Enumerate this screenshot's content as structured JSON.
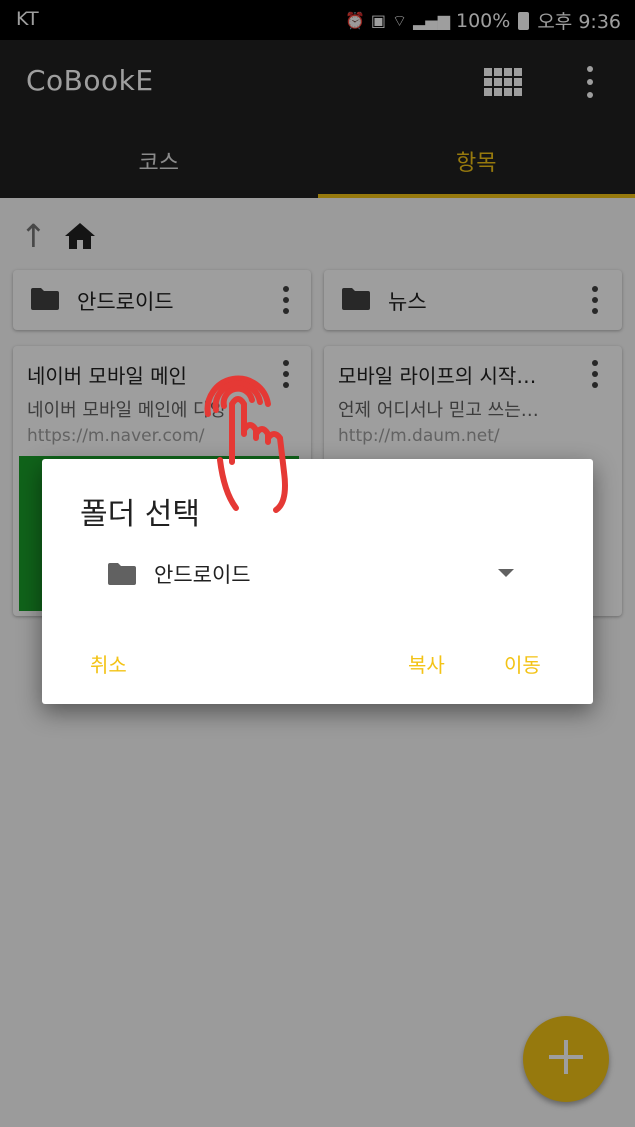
{
  "status_bar": {
    "carrier": "KT",
    "icons": [
      "alarm-icon",
      "hd-icon",
      "wifi-icon",
      "signal-icon"
    ],
    "battery": "100%",
    "time": "오후 9:36"
  },
  "toolbar": {
    "title": "CoBookE",
    "icons": [
      "grid-view-icon",
      "overflow-menu-icon"
    ]
  },
  "tabs": [
    {
      "label": "코스",
      "active": false
    },
    {
      "label": "항목",
      "active": true
    }
  ],
  "folders": [
    {
      "label": "안드로이드"
    },
    {
      "label": "뉴스"
    }
  ],
  "items": [
    {
      "title": "네이버 모바일 메인",
      "description": "네이버 모바일 메인에 다양",
      "url": "https://m.naver.com/"
    },
    {
      "title": "모바일 라이프의 시작…",
      "description": "언제 어디서나 믿고 쓰는…",
      "url": "http://m.daum.net/"
    }
  ],
  "dialog": {
    "title": "폴더 선택",
    "selected_folder": "안드로이드",
    "cancel_label": "취소",
    "copy_label": "복사",
    "move_label": "이동"
  },
  "colors": {
    "accent": "#f3c316",
    "toolbar": "#212121",
    "statusbar": "#000000",
    "thumbnail": "#1aa02a",
    "touch_indicator": "#e53935"
  }
}
